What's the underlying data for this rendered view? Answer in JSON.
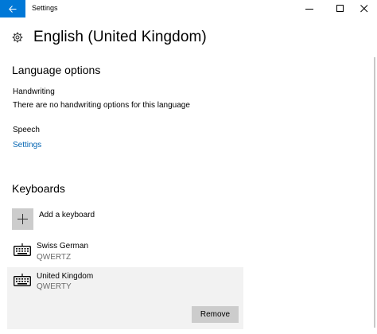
{
  "window": {
    "title": "Settings"
  },
  "header": {
    "title": "English (United Kingdom)",
    "icon": "gear-icon"
  },
  "language_options": {
    "title": "Language options",
    "handwriting_label": "Handwriting",
    "handwriting_text": "There are no handwriting options for this language",
    "speech_label": "Speech",
    "speech_link": "Settings"
  },
  "keyboards": {
    "title": "Keyboards",
    "add_label": "Add a keyboard",
    "items": [
      {
        "name": "Swiss German",
        "layout": "QWERTZ",
        "selected": false
      },
      {
        "name": "United Kingdom",
        "layout": "QWERTY",
        "selected": true
      }
    ],
    "remove_label": "Remove"
  },
  "colors": {
    "accent": "#0078d7",
    "link": "#0063b1",
    "selected_bg": "#f2f2f2",
    "button_bg": "#cccccc"
  }
}
